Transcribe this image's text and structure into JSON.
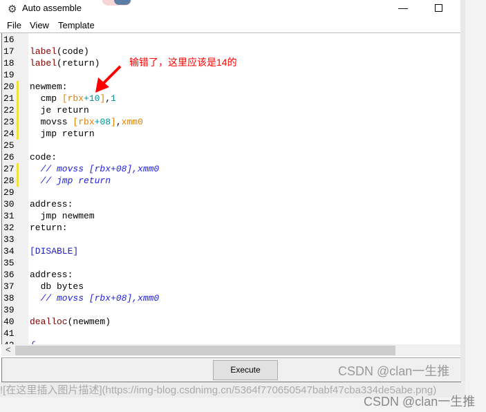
{
  "window": {
    "title": "Auto assemble",
    "icon": "gear-icon"
  },
  "menu": [
    "File",
    "View",
    "Template"
  ],
  "editor": {
    "lines": [
      {
        "n": "16",
        "mark": false,
        "t": []
      },
      {
        "n": "17",
        "mark": false,
        "t": [
          [
            "lb",
            "label"
          ],
          [
            "k",
            "(code)"
          ]
        ]
      },
      {
        "n": "18",
        "mark": false,
        "t": [
          [
            "lb",
            "label"
          ],
          [
            "k",
            "(return)"
          ]
        ]
      },
      {
        "n": "19",
        "mark": false,
        "t": []
      },
      {
        "n": "20",
        "mark": true,
        "t": [
          [
            "k",
            "newmem:"
          ]
        ]
      },
      {
        "n": "21",
        "mark": true,
        "t": [
          [
            "k",
            "  cmp "
          ],
          [
            "br",
            "[rbx"
          ],
          [
            "num",
            "+10"
          ],
          [
            "br",
            "]"
          ],
          [
            "k",
            ","
          ],
          [
            "num",
            "1"
          ]
        ]
      },
      {
        "n": "22",
        "mark": true,
        "t": [
          [
            "k",
            "  je return"
          ]
        ]
      },
      {
        "n": "23",
        "mark": true,
        "t": [
          [
            "k",
            "  movss "
          ],
          [
            "br",
            "[rbx"
          ],
          [
            "num",
            "+08"
          ],
          [
            "br",
            "]"
          ],
          [
            "k",
            ","
          ],
          [
            "br",
            "xmm0"
          ]
        ]
      },
      {
        "n": "24",
        "mark": true,
        "t": [
          [
            "k",
            "  jmp return"
          ]
        ]
      },
      {
        "n": "25",
        "mark": false,
        "t": []
      },
      {
        "n": "26",
        "mark": false,
        "t": [
          [
            "k",
            "code:"
          ]
        ]
      },
      {
        "n": "27",
        "mark": true,
        "t": [
          [
            "cm",
            "  // movss [rbx+08],xmm0"
          ]
        ]
      },
      {
        "n": "28",
        "mark": true,
        "t": [
          [
            "cm",
            "  // jmp return"
          ]
        ]
      },
      {
        "n": "29",
        "mark": false,
        "t": []
      },
      {
        "n": "30",
        "mark": false,
        "t": [
          [
            "k",
            "address:"
          ]
        ]
      },
      {
        "n": "31",
        "mark": false,
        "t": [
          [
            "k",
            "  jmp newmem"
          ]
        ]
      },
      {
        "n": "32",
        "mark": false,
        "t": [
          [
            "k",
            "return:"
          ]
        ]
      },
      {
        "n": "33",
        "mark": false,
        "t": []
      },
      {
        "n": "34",
        "mark": false,
        "t": [
          [
            "sec",
            "[DISABLE]"
          ]
        ]
      },
      {
        "n": "35",
        "mark": false,
        "t": []
      },
      {
        "n": "36",
        "mark": false,
        "t": [
          [
            "k",
            "address:"
          ]
        ]
      },
      {
        "n": "37",
        "mark": false,
        "t": [
          [
            "k",
            "  db bytes"
          ]
        ]
      },
      {
        "n": "38",
        "mark": false,
        "t": [
          [
            "cm",
            "  // movss [rbx+08],xmm0"
          ]
        ]
      },
      {
        "n": "39",
        "mark": false,
        "t": []
      },
      {
        "n": "40",
        "mark": false,
        "t": [
          [
            "lb",
            "dealloc"
          ],
          [
            "k",
            "(newmem)"
          ]
        ]
      },
      {
        "n": "41",
        "mark": false,
        "t": []
      },
      {
        "n": "42",
        "mark": false,
        "t": [
          [
            "cm",
            "{"
          ]
        ]
      }
    ]
  },
  "annotation": "输错了，这里应该是14的",
  "execute_label": "Execute",
  "watermark": "CSDN @clan一生推",
  "markdown_line": "![在这里插入图片描述](https://img-blog.csdnimg.cn/5364f770650547babf47cba334de5abe.png)"
}
